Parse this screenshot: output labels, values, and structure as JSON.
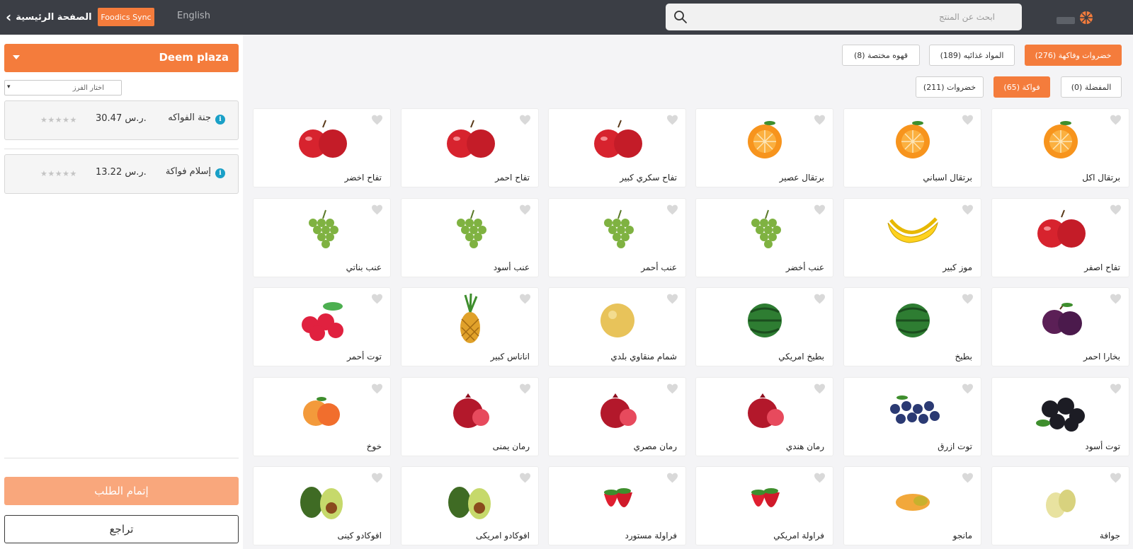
{
  "topbar": {
    "home_label": "الصفحة الرئيسية",
    "sync_label": "Foodics Sync",
    "language_label": "English",
    "search_placeholder": "ابحث عن المنتج",
    "search_value": ""
  },
  "sidebar": {
    "branch_name": "Deem plaza",
    "sort_label": "اختار الفرز",
    "vendors": [
      {
        "name": "جنة الفواكه",
        "price": "30.47 ر.س.",
        "rating": "★★★★★"
      },
      {
        "name": "إسلام فواكة",
        "price": "13.22 ر.س.",
        "rating": "★★★★★"
      }
    ],
    "checkout_label": "إتمام الطلب",
    "cancel_label": "تراجع"
  },
  "categories": [
    {
      "label": "خضروات وفاكهة (276)",
      "active": true
    },
    {
      "label": "المواد غذائيه (189)",
      "active": false
    },
    {
      "label": "قهوه مختصة (8)",
      "active": false
    }
  ],
  "subcategories": [
    {
      "label": "المفضلة (0)",
      "active": false
    },
    {
      "label": "فواكة (65)",
      "active": true
    },
    {
      "label": "خضروات (211)",
      "active": false
    }
  ],
  "products": [
    {
      "name": "برتقال اكل",
      "icon": "orange"
    },
    {
      "name": "برتقال اسباني",
      "icon": "orange"
    },
    {
      "name": "برتقال عصير",
      "icon": "orange"
    },
    {
      "name": "تفاح سكري كبير",
      "icon": "apple"
    },
    {
      "name": "تفاح احمر",
      "icon": "apple"
    },
    {
      "name": "تفاح اخضر",
      "icon": "apple"
    },
    {
      "name": "تفاح اصفر",
      "icon": "apple"
    },
    {
      "name": "موز كبير",
      "icon": "banana"
    },
    {
      "name": "عنب أخضر",
      "icon": "grapes"
    },
    {
      "name": "عنب أحمر",
      "icon": "grapes"
    },
    {
      "name": "عنب أسود",
      "icon": "grapes"
    },
    {
      "name": "عنب بناتي",
      "icon": "grapes"
    },
    {
      "name": "بخارا احمر",
      "icon": "plum"
    },
    {
      "name": "بطيخ",
      "icon": "watermelon"
    },
    {
      "name": "بطيخ امريكي",
      "icon": "watermelon"
    },
    {
      "name": "شمام منقاوي بلدي",
      "icon": "melon"
    },
    {
      "name": "اناناس كبير",
      "icon": "pineapple"
    },
    {
      "name": "توت أحمر",
      "icon": "raspberry"
    },
    {
      "name": "توت أسود",
      "icon": "blackberry"
    },
    {
      "name": "توت ازرق",
      "icon": "blueberry"
    },
    {
      "name": "رمان هندي",
      "icon": "pomegranate"
    },
    {
      "name": "رمان مصري",
      "icon": "pomegranate"
    },
    {
      "name": "رمان يمنى",
      "icon": "pomegranate"
    },
    {
      "name": "خوخ",
      "icon": "peach"
    },
    {
      "name": "جوافة",
      "icon": "guava"
    },
    {
      "name": "مانجو",
      "icon": "mango"
    },
    {
      "name": "فراولة امريكي",
      "icon": "strawberry"
    },
    {
      "name": "فراولة مستورد",
      "icon": "strawberry"
    },
    {
      "name": "افوكادو امريكى",
      "icon": "avocado"
    },
    {
      "name": "افوكادو كينى",
      "icon": "avocado"
    }
  ],
  "colors": {
    "accent": "#f47c3c",
    "accent_light": "#f9a77c",
    "topbar": "#3b3e45",
    "info": "#1aa0c7"
  }
}
